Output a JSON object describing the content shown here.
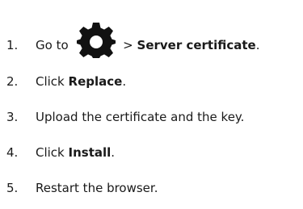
{
  "steps": [
    {
      "number": "1.",
      "before": "Go to ",
      "icon": "gear-icon",
      "between": " > ",
      "bold": "Server certificate",
      "after": "."
    },
    {
      "number": "2.",
      "before": "Click ",
      "bold": "Replace",
      "after": "."
    },
    {
      "number": "3.",
      "text": "Upload the certificate and the key."
    },
    {
      "number": "4.",
      "before": "Click ",
      "bold": "Install",
      "after": "."
    },
    {
      "number": "5.",
      "text": "Restart the browser."
    }
  ],
  "colors": {
    "text": "#1a1a1a",
    "icon": "#111111"
  }
}
